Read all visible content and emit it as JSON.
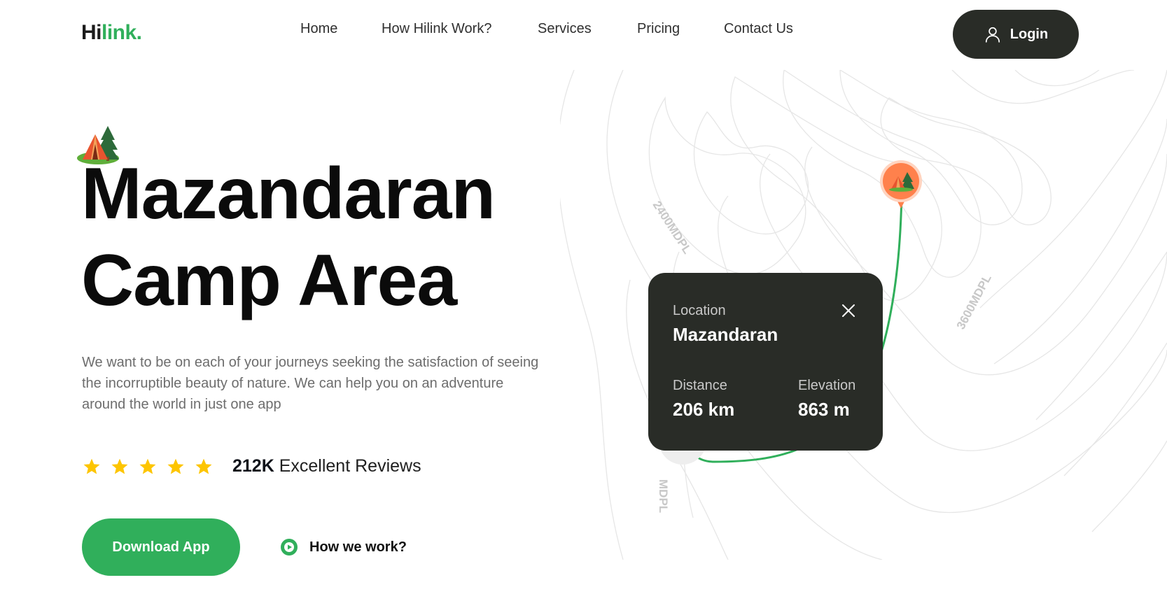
{
  "brand": {
    "logo_part1": "Hi",
    "logo_part2": "link.",
    "accent": "#30af5b",
    "dark": "#292c27"
  },
  "nav": {
    "items": [
      {
        "label": "Home"
      },
      {
        "label": "How Hilink Work?"
      },
      {
        "label": "Services"
      },
      {
        "label": "Pricing"
      },
      {
        "label": "Contact Us"
      }
    ],
    "login_label": "Login",
    "login_icon": "user-icon"
  },
  "hero": {
    "icon": "camp-icon",
    "title_line1": "Mazandaran",
    "title_line2": "Camp Area",
    "description": "We want to be on each of your journeys seeking the satisfaction of seeing the incorruptible beauty of nature. We can help you on an adventure around the world in just one app",
    "rating": {
      "stars": 5,
      "count": "212K",
      "text": "Excellent Reviews",
      "star_color": "#fdc500"
    },
    "download_label": "Download App",
    "how_label": "How we work?"
  },
  "map": {
    "contour_labels": [
      "2400MDPL",
      "3600MDPL",
      "MDPL"
    ],
    "pin_color": "#ff814c",
    "route_color": "#30af5b"
  },
  "location_card": {
    "location_label": "Location",
    "location_value": "Mazandaran",
    "distance_label": "Distance",
    "distance_value": "206 km",
    "elevation_label": "Elevation",
    "elevation_value": "863 m"
  }
}
